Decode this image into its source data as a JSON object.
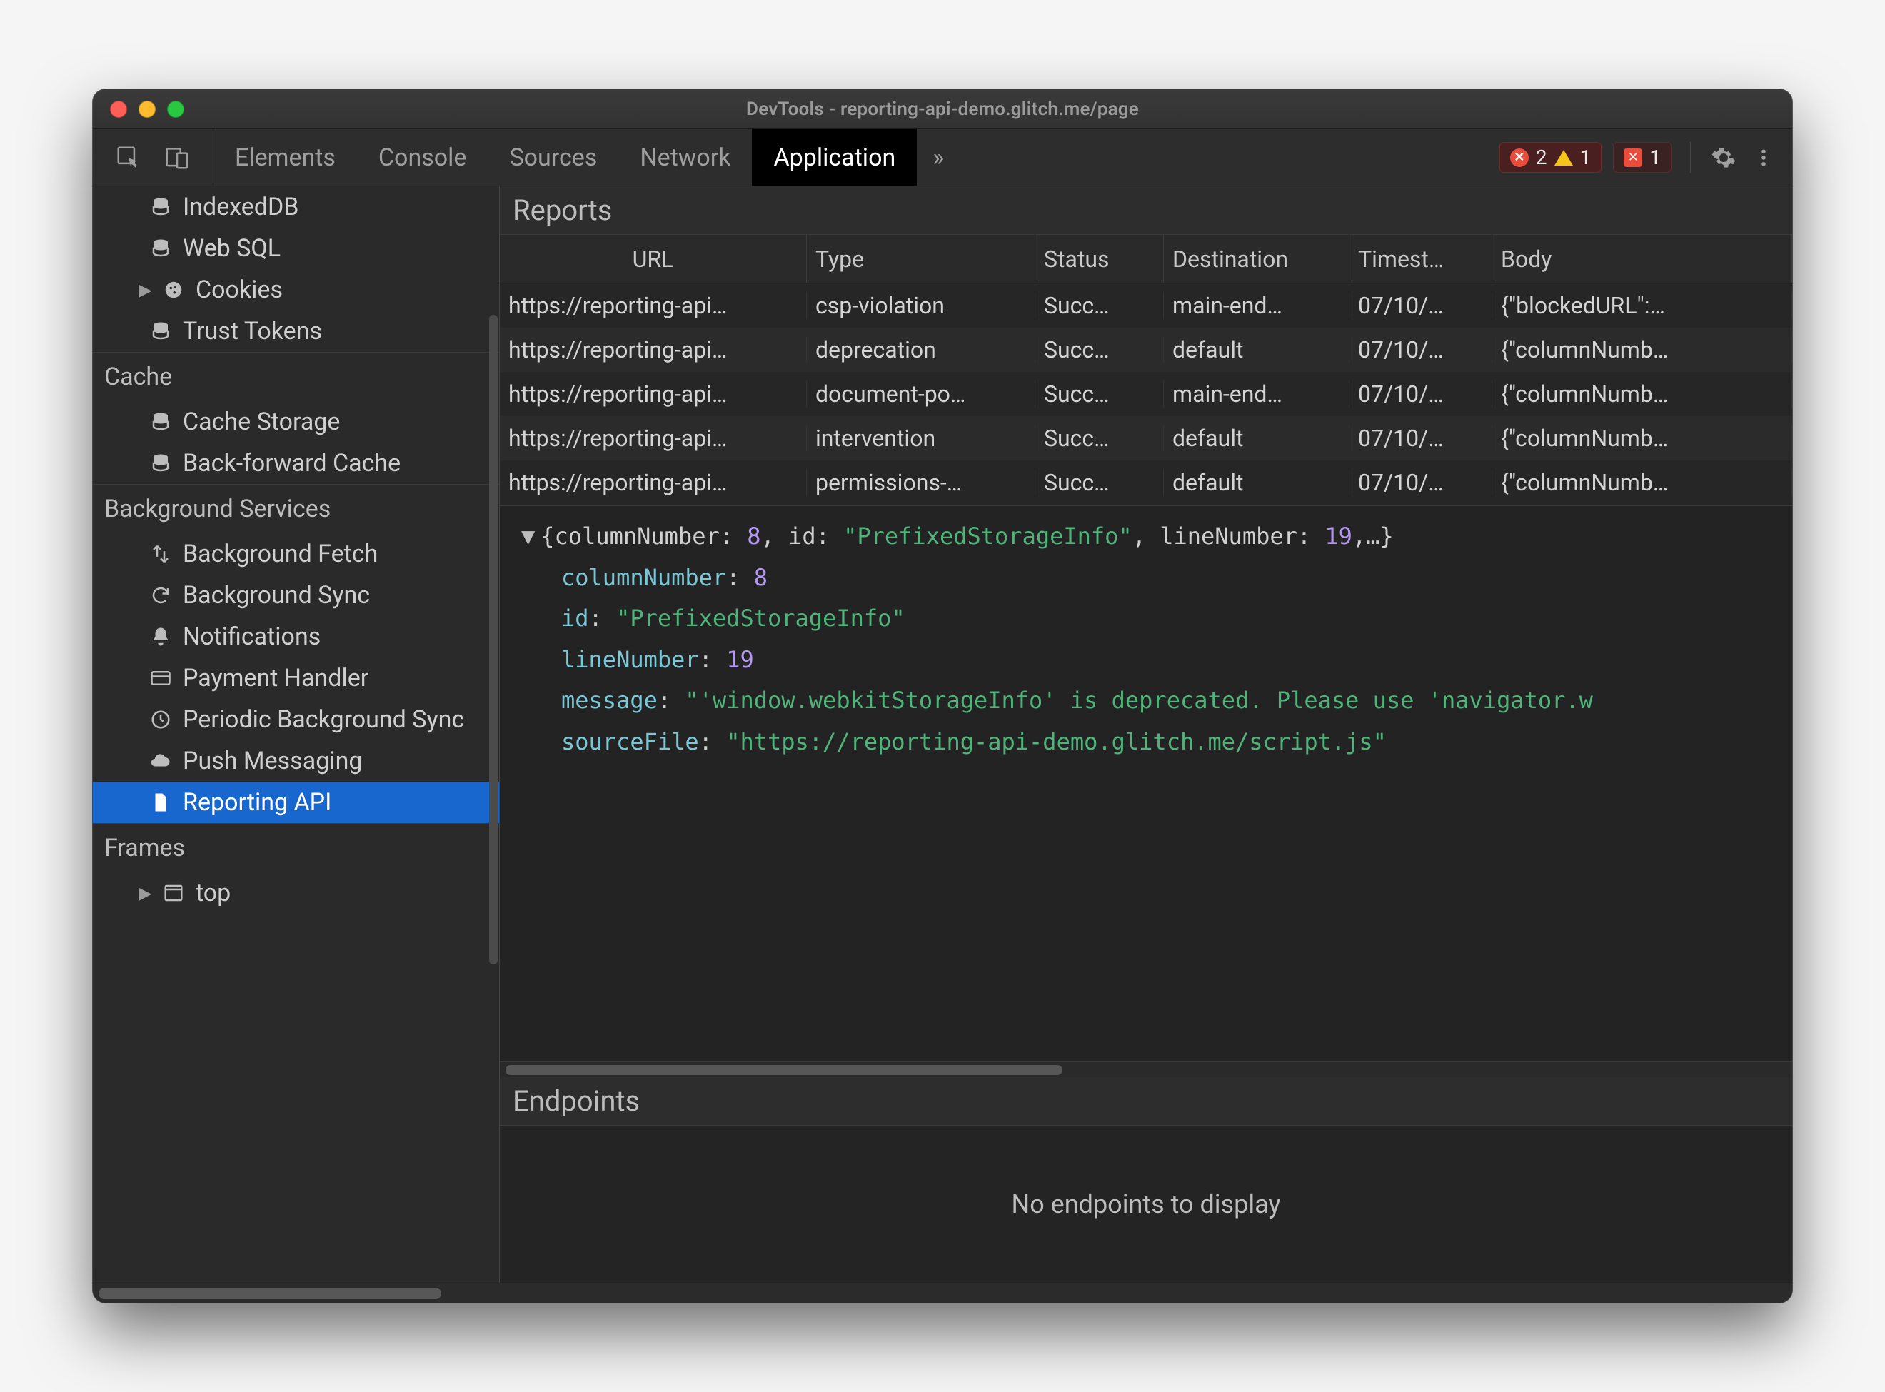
{
  "window": {
    "title": "DevTools - reporting-api-demo.glitch.me/page"
  },
  "toolbar": {
    "tabs": [
      "Elements",
      "Console",
      "Sources",
      "Network",
      "Application"
    ],
    "active_tab_index": 4,
    "overflow_glyph": "»",
    "error_count": "2",
    "warn_count": "1",
    "issue_count": "1"
  },
  "sidebar": {
    "storage_items": [
      {
        "label": "IndexedDB",
        "icon": "database"
      },
      {
        "label": "Web SQL",
        "icon": "database"
      },
      {
        "label": "Cookies",
        "icon": "cookie",
        "expander": true
      },
      {
        "label": "Trust Tokens",
        "icon": "database"
      }
    ],
    "cache_title": "Cache",
    "cache_items": [
      {
        "label": "Cache Storage",
        "icon": "database"
      },
      {
        "label": "Back-forward Cache",
        "icon": "database"
      }
    ],
    "bg_title": "Background Services",
    "bg_items": [
      {
        "label": "Background Fetch",
        "icon": "transfer"
      },
      {
        "label": "Background Sync",
        "icon": "sync"
      },
      {
        "label": "Notifications",
        "icon": "bell"
      },
      {
        "label": "Payment Handler",
        "icon": "card"
      },
      {
        "label": "Periodic Background Sync",
        "icon": "clock"
      },
      {
        "label": "Push Messaging",
        "icon": "cloud"
      },
      {
        "label": "Reporting API",
        "icon": "file",
        "active": true
      }
    ],
    "frames_title": "Frames",
    "frames_items": [
      {
        "label": "top",
        "icon": "frame",
        "expander": true
      }
    ]
  },
  "reports": {
    "title": "Reports",
    "columns": [
      "URL",
      "Type",
      "Status",
      "Destination",
      "Timest…",
      "Body"
    ],
    "rows": [
      {
        "url": "https://reporting-api…",
        "type": "csp-violation",
        "status": "Succ…",
        "destination": "main-end…",
        "timestamp": "07/10/…",
        "body": "{\"blockedURL\":…"
      },
      {
        "url": "https://reporting-api…",
        "type": "deprecation",
        "status": "Succ…",
        "destination": "default",
        "timestamp": "07/10/…",
        "body": "{\"columnNumb…"
      },
      {
        "url": "https://reporting-api…",
        "type": "document-po…",
        "status": "Succ…",
        "destination": "main-end…",
        "timestamp": "07/10/…",
        "body": "{\"columnNumb…"
      },
      {
        "url": "https://reporting-api…",
        "type": "intervention",
        "status": "Succ…",
        "destination": "default",
        "timestamp": "07/10/…",
        "body": "{\"columnNumb…"
      },
      {
        "url": "https://reporting-api…",
        "type": "permissions-…",
        "status": "Succ…",
        "destination": "default",
        "timestamp": "07/10/…",
        "body": "{\"columnNumb…"
      }
    ],
    "detail": {
      "summary_prefix": "{columnNumber: ",
      "summary_col": "8",
      "summary_mid1": ", id: ",
      "summary_id": "\"PrefixedStorageInfo\"",
      "summary_mid2": ", lineNumber: ",
      "summary_line": "19",
      "summary_suffix": ",…}",
      "k_columnNumber": "columnNumber",
      "v_columnNumber": "8",
      "k_id": "id",
      "v_id": "\"PrefixedStorageInfo\"",
      "k_lineNumber": "lineNumber",
      "v_lineNumber": "19",
      "k_message": "message",
      "v_message": "\"'window.webkitStorageInfo' is deprecated. Please use 'navigator.w",
      "k_sourceFile": "sourceFile",
      "v_sourceFile": "\"https://reporting-api-demo.glitch.me/script.js\""
    }
  },
  "endpoints": {
    "title": "Endpoints",
    "empty_text": "No endpoints to display"
  }
}
